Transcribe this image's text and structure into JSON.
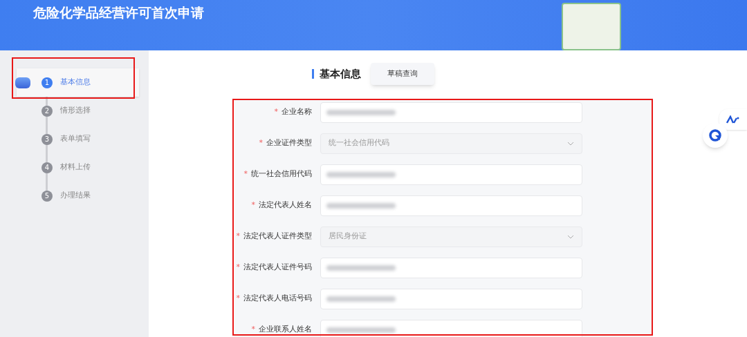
{
  "header": {
    "title": "危险化学品经营许可首次申请"
  },
  "steps": [
    {
      "number": "1",
      "label": "基本信息",
      "selected": true
    },
    {
      "number": "2",
      "label": "情形选择",
      "selected": false
    },
    {
      "number": "3",
      "label": "表单填写",
      "selected": false
    },
    {
      "number": "4",
      "label": "材料上传",
      "selected": false
    },
    {
      "number": "5",
      "label": "办理结果",
      "selected": false
    }
  ],
  "section": {
    "title": "基本信息",
    "draft_button": "草稿查询"
  },
  "form": {
    "fields": [
      {
        "required_mark": "*",
        "label": "企业名称",
        "kind": "text",
        "redacted": true
      },
      {
        "required_mark": "*",
        "label": "企业证件类型",
        "kind": "select",
        "value": "统一社会信用代码"
      },
      {
        "required_mark": "*",
        "label": "统一社会信用代码",
        "kind": "text",
        "redacted": true
      },
      {
        "required_mark": "*",
        "label": "法定代表人姓名",
        "kind": "text",
        "redacted": true
      },
      {
        "required_mark": "*",
        "label": "法定代表人证件类型",
        "kind": "select",
        "value": "居民身份证"
      },
      {
        "required_mark": "*",
        "label": "法定代表人证件号码",
        "kind": "text",
        "redacted": true
      },
      {
        "required_mark": "*",
        "label": "法定代表人电话号码",
        "kind": "text",
        "redacted": true
      },
      {
        "required_mark": "*",
        "label": "企业联系人姓名",
        "kind": "text",
        "redacted": true
      }
    ]
  }
}
